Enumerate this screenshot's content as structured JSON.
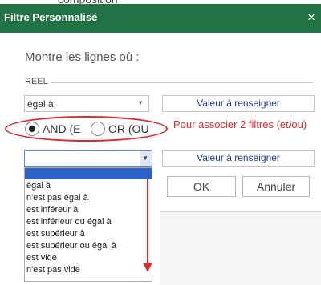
{
  "caption_fragment": "composition",
  "dialog": {
    "title": "Filtre Personnalisé",
    "close_glyph": "×",
    "heading": "Montre les lignes où :",
    "field_label": "REEL"
  },
  "row1": {
    "operator": "égal à",
    "value": "Valeur à renseigner"
  },
  "logic": {
    "and_label": "AND (E",
    "or_label": "OR (OU",
    "selected": "AND"
  },
  "annotation": "Pour associer 2 filtres (et/ou)",
  "row2": {
    "operator": "",
    "value": "Valeur à renseigner"
  },
  "dropdown_options": [
    "égal à",
    "n'est pas égal à",
    "est inféreur à",
    "est inférieur ou égal à",
    "est supérieur à",
    "est supérieur ou égal à",
    "est vide",
    "n'est pas vide"
  ],
  "buttons": {
    "ok": "OK",
    "cancel": "Annuler"
  },
  "colors": {
    "titlebar": "#217346",
    "annotation": "#e0282f",
    "selection": "#2a62c6"
  }
}
